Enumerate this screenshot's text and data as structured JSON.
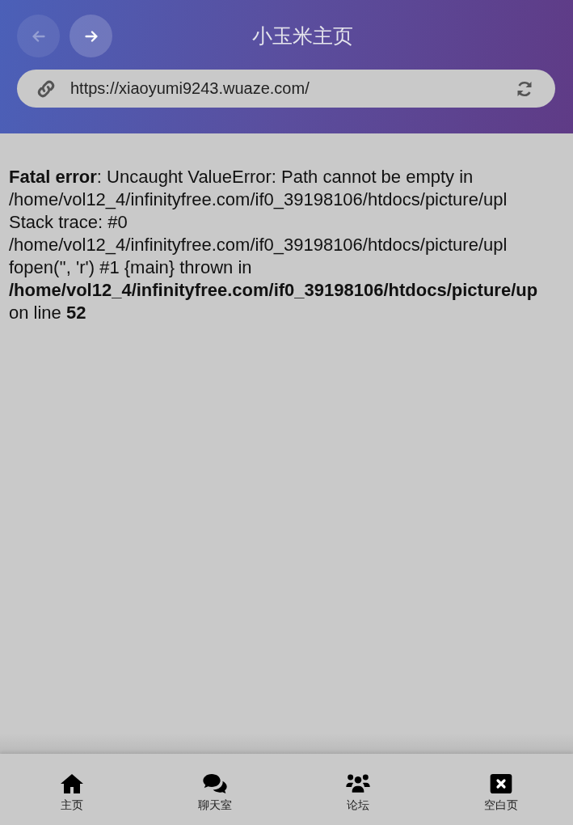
{
  "header": {
    "title": "小玉米主页",
    "back": {
      "disabled": true
    },
    "forward": {
      "disabled": false
    },
    "address": {
      "value": "https://xiaoyumi9243.wuaze.com/"
    }
  },
  "content": {
    "lines": [
      "**Fatal error**: Uncaught ValueError: Path cannot be empty in",
      "/home/vol12_4/infinityfree.com/if0_39198106/htdocs/picture/upl",
      "Stack trace: #0",
      "/home/vol12_4/infinityfree.com/if0_39198106/htdocs/picture/upl",
      "fopen('', 'r') #1 {main} thrown in",
      "**/home/vol12_4/infinityfree.com/if0_39198106/htdocs/picture/up**",
      "on line **52**"
    ]
  },
  "nav": [
    {
      "kind": "home",
      "label": "主页"
    },
    {
      "kind": "chat",
      "label": "聊天室"
    },
    {
      "kind": "forum",
      "label": "论坛"
    },
    {
      "kind": "blank",
      "label": "空白页"
    }
  ]
}
